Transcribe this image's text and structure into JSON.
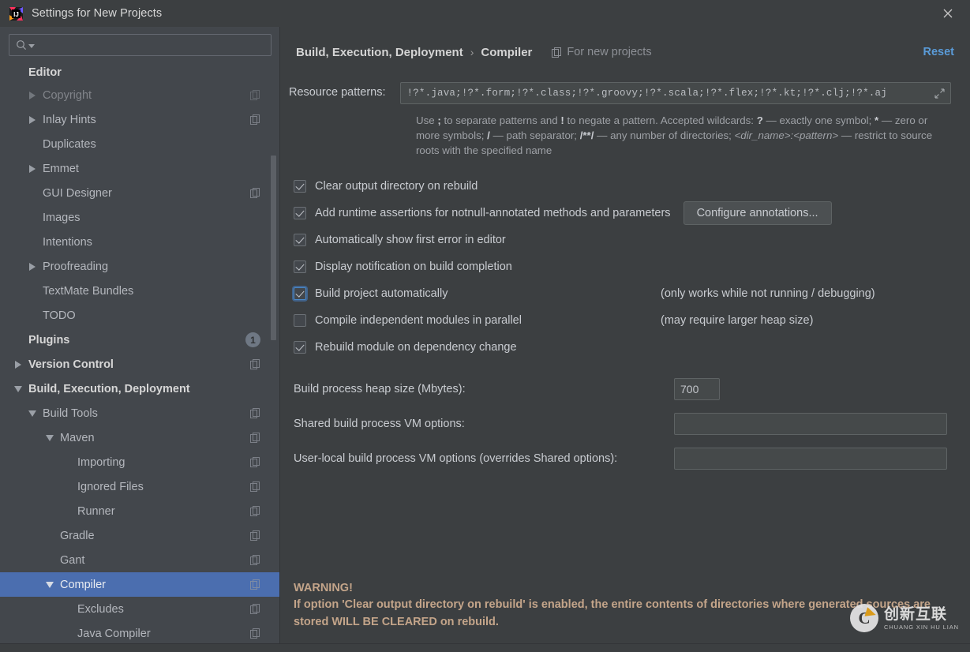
{
  "window": {
    "title": "Settings for New Projects",
    "logo_icon": "intellij-idea-logo",
    "close_icon": "close-icon"
  },
  "sidebar": {
    "search": {
      "placeholder": "",
      "value": "",
      "icon": "search-icon",
      "dropdown_icon": "chevron-down-icon"
    },
    "sticky_header": "Editor",
    "items": [
      {
        "label": "Copyright",
        "indent": 1,
        "arrow": "closed",
        "icon": "copy-settings-icon",
        "clipped": true
      },
      {
        "label": "Inlay Hints",
        "indent": 1,
        "arrow": "closed",
        "icon": "copy-settings-icon"
      },
      {
        "label": "Duplicates",
        "indent": 1,
        "arrow": "none",
        "icon": ""
      },
      {
        "label": "Emmet",
        "indent": 1,
        "arrow": "closed",
        "icon": ""
      },
      {
        "label": "GUI Designer",
        "indent": 1,
        "arrow": "none",
        "icon": "copy-settings-icon"
      },
      {
        "label": "Images",
        "indent": 1,
        "arrow": "none",
        "icon": ""
      },
      {
        "label": "Intentions",
        "indent": 1,
        "arrow": "none",
        "icon": ""
      },
      {
        "label": "Proofreading",
        "indent": 1,
        "arrow": "closed",
        "icon": ""
      },
      {
        "label": "TextMate Bundles",
        "indent": 1,
        "arrow": "none",
        "icon": ""
      },
      {
        "label": "TODO",
        "indent": 1,
        "arrow": "none",
        "icon": ""
      },
      {
        "label": "Plugins",
        "indent": 0,
        "arrow": "none",
        "icon": "",
        "bold": true,
        "badge": "1"
      },
      {
        "label": "Version Control",
        "indent": 0,
        "arrow": "closed",
        "icon": "copy-settings-icon",
        "bold": true
      },
      {
        "label": "Build, Execution, Deployment",
        "indent": 0,
        "arrow": "open",
        "icon": "",
        "bold": true
      },
      {
        "label": "Build Tools",
        "indent": 1,
        "arrow": "open",
        "icon": "copy-settings-icon"
      },
      {
        "label": "Maven",
        "indent": 2,
        "arrow": "open",
        "icon": "copy-settings-icon"
      },
      {
        "label": "Importing",
        "indent": 3,
        "arrow": "none",
        "icon": "copy-settings-icon"
      },
      {
        "label": "Ignored Files",
        "indent": 3,
        "arrow": "none",
        "icon": "copy-settings-icon"
      },
      {
        "label": "Runner",
        "indent": 3,
        "arrow": "none",
        "icon": "copy-settings-icon"
      },
      {
        "label": "Gradle",
        "indent": 2,
        "arrow": "none",
        "icon": "copy-settings-icon"
      },
      {
        "label": "Gant",
        "indent": 2,
        "arrow": "none",
        "icon": "copy-settings-icon"
      },
      {
        "label": "Compiler",
        "indent": 2,
        "arrow": "open",
        "icon": "copy-settings-icon",
        "selected": true
      },
      {
        "label": "Excludes",
        "indent": 3,
        "arrow": "none",
        "icon": "copy-settings-icon"
      },
      {
        "label": "Java Compiler",
        "indent": 3,
        "arrow": "none",
        "icon": "copy-settings-icon"
      }
    ]
  },
  "header": {
    "breadcrumb_root": "Build, Execution, Deployment",
    "breadcrumb_sep": "›",
    "breadcrumb_leaf": "Compiler",
    "for_new_projects": "For new projects",
    "for_new_projects_icon": "copy-settings-icon",
    "reset_label": "Reset"
  },
  "main": {
    "resource_patterns_label": "Resource patterns:",
    "resource_patterns_value": "!?*.java;!?*.form;!?*.class;!?*.groovy;!?*.scala;!?*.flex;!?*.kt;!?*.clj;!?*.aj",
    "expand_icon": "expand-icon",
    "hint_part1": "Use ",
    "hint_semicolon": ";",
    "hint_part2": " to separate patterns and ",
    "hint_bang": "!",
    "hint_part3": " to negate a pattern. Accepted wildcards: ",
    "hint_q": "?",
    "hint_part4": " — exactly one symbol; ",
    "hint_star": "*",
    "hint_part5": " — zero or more symbols; ",
    "hint_slash": "/",
    "hint_part6": " — path separator; ",
    "hint_globstar": "/**/",
    "hint_part7": " — any number of directories; ",
    "hint_dirname": "<dir_name>:<pattern>",
    "hint_part8": " — restrict to source roots with the specified name",
    "checkboxes": [
      {
        "label": "Clear output directory on rebuild",
        "checked": true,
        "focused": false,
        "note": "",
        "button": ""
      },
      {
        "label": "Add runtime assertions for notnull-annotated methods and parameters",
        "checked": true,
        "focused": false,
        "note": "",
        "button": "Configure annotations..."
      },
      {
        "label": "Automatically show first error in editor",
        "checked": true,
        "focused": false,
        "note": "",
        "button": ""
      },
      {
        "label": "Display notification on build completion",
        "checked": true,
        "focused": false,
        "note": "",
        "button": ""
      },
      {
        "label": "Build project automatically",
        "checked": true,
        "focused": true,
        "note": "(only works while not running / debugging)",
        "button": ""
      },
      {
        "label": "Compile independent modules in parallel",
        "checked": false,
        "focused": false,
        "note": "(may require larger heap size)",
        "button": ""
      },
      {
        "label": "Rebuild module on dependency change",
        "checked": true,
        "focused": false,
        "note": "",
        "button": ""
      }
    ],
    "fields": [
      {
        "label": "Build process heap size (Mbytes):",
        "value": "700",
        "size": "small"
      },
      {
        "label": "Shared build process VM options:",
        "value": "",
        "size": "wide"
      },
      {
        "label": "User-local build process VM options (overrides Shared options):",
        "value": "",
        "size": "wide"
      }
    ],
    "warning_heading": "WARNING!",
    "warning_text": "If option 'Clear output directory on rebuild' is enabled, the entire contents of directories where generated sources are stored WILL BE CLEARED on rebuild."
  },
  "watermark": {
    "mark": "C",
    "cn": "创新互联",
    "pinyin": "CHUANG XIN HU LIAN"
  },
  "colors": {
    "accent_selection": "#4b6eaf",
    "link": "#5a9bd8",
    "warning": "#c4a58a",
    "panel": "#3c3f41",
    "sidebar": "#43474c"
  }
}
